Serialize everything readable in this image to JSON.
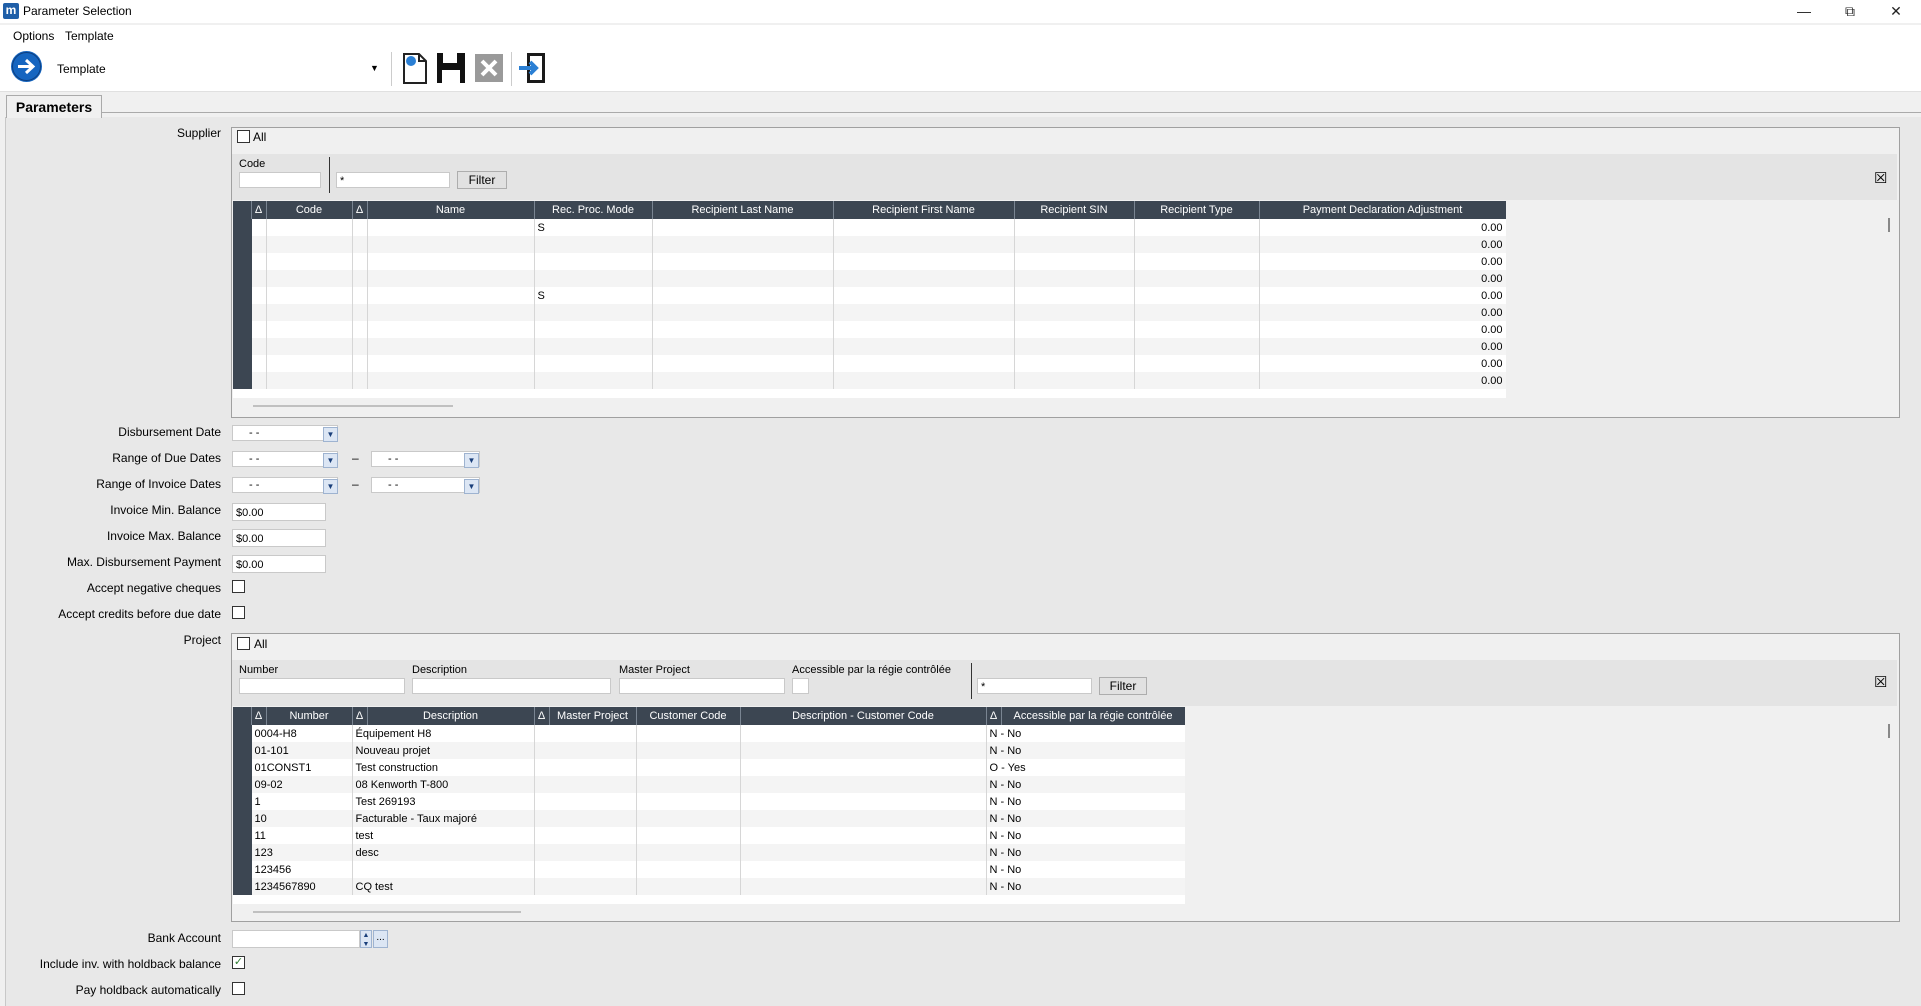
{
  "window": {
    "title": "Parameter Selection",
    "app_icon": "m"
  },
  "menu": [
    "Options",
    "Template"
  ],
  "toolbar": {
    "template_label": "Template"
  },
  "tab": {
    "label": "Parameters"
  },
  "supplier": {
    "label": "Supplier",
    "all_label": "All",
    "filter": {
      "code_label": "Code",
      "wildcard": "*",
      "filter_btn": "Filter"
    },
    "columns": [
      "Δ",
      "Code",
      "Δ",
      "Name",
      "Rec. Proc. Mode",
      "Recipient Last Name",
      "Recipient First Name",
      "Recipient SIN",
      "Recipient Type",
      "Payment Declaration Adjustment"
    ],
    "rows": [
      {
        "mode": "S",
        "adj": "0.00"
      },
      {
        "mode": "",
        "adj": "0.00"
      },
      {
        "mode": "",
        "adj": "0.00"
      },
      {
        "mode": "",
        "adj": "0.00"
      },
      {
        "mode": "S",
        "adj": "0.00"
      },
      {
        "mode": "",
        "adj": "0.00"
      },
      {
        "mode": "",
        "adj": "0.00"
      },
      {
        "mode": "",
        "adj": "0.00"
      },
      {
        "mode": "",
        "adj": "0.00"
      },
      {
        "mode": "",
        "adj": "0.00"
      }
    ]
  },
  "fields": {
    "disbursement_date": {
      "label": "Disbursement Date",
      "value": "- -"
    },
    "due_dates": {
      "label": "Range of Due Dates",
      "from": "- -",
      "to": "- -",
      "sep": "–"
    },
    "invoice_dates": {
      "label": "Range of Invoice Dates",
      "from": "- -",
      "to": "- -",
      "sep": "–"
    },
    "inv_min": {
      "label": "Invoice Min. Balance",
      "value": "$0.00"
    },
    "inv_max": {
      "label": "Invoice Max. Balance",
      "value": "$0.00"
    },
    "max_disb": {
      "label": "Max. Disbursement Payment",
      "value": "$0.00"
    },
    "neg_cheques": {
      "label": "Accept negative cheques",
      "checked": false
    },
    "credits": {
      "label": "Accept credits before due date",
      "checked": false
    },
    "bank": {
      "label": "Bank Account",
      "value": ""
    },
    "holdback_bal": {
      "label": "Include inv. with holdback balance",
      "checked": true
    },
    "holdback_auto": {
      "label": "Pay holdback automatically",
      "checked": false
    }
  },
  "project": {
    "label": "Project",
    "all_label": "All",
    "filter": {
      "number_label": "Number",
      "description_label": "Description",
      "master_label": "Master Project",
      "access_label": "Accessible par la régie contrôlée",
      "wildcard": "*",
      "filter_btn": "Filter"
    },
    "columns": [
      "Δ",
      "Number",
      "Δ",
      "Description",
      "Δ",
      "Master Project",
      "Customer Code",
      "Description - Customer Code",
      "Δ",
      "Accessible par la régie contrôlée"
    ],
    "rows": [
      {
        "number": "0004-H8",
        "description": "Équipement H8",
        "access": "N - No"
      },
      {
        "number": "01-101",
        "description": "Nouveau projet",
        "access": "N - No"
      },
      {
        "number": "01CONST1",
        "description": "Test construction",
        "access": "O - Yes"
      },
      {
        "number": "09-02",
        "description": "08 Kenworth T-800",
        "access": "N - No"
      },
      {
        "number": "1",
        "description": "Test 269193",
        "access": "N - No"
      },
      {
        "number": "10",
        "description": "Facturable - Taux majoré",
        "access": "N - No"
      },
      {
        "number": "11",
        "description": "test",
        "access": "N - No"
      },
      {
        "number": "123",
        "description": "desc",
        "access": "N - No"
      },
      {
        "number": "123456",
        "description": "",
        "access": "N - No"
      },
      {
        "number": "1234567890",
        "description": "CQ test",
        "access": "N - No"
      }
    ]
  }
}
